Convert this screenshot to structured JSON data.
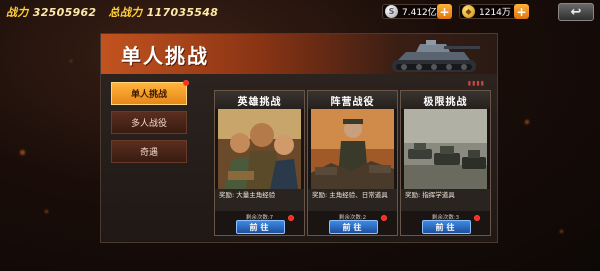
{
  "top_bar": {
    "power_label": "战力",
    "power_value": "32505962",
    "total_power_label": "总战力",
    "total_power_value": "117035548",
    "silver_amount": "7.412亿",
    "gold_amount": "1214万",
    "add_symbol": "+"
  },
  "panel": {
    "title": "单人挑战"
  },
  "nav": {
    "items": [
      {
        "label": "单人挑战"
      },
      {
        "label": "多人战役"
      },
      {
        "label": "奇遇"
      }
    ]
  },
  "cards": [
    {
      "title": "英雄挑战",
      "reward": "奖励: 大量主角经验",
      "remaining": "剩余次数:7",
      "button": "前往"
    },
    {
      "title": "阵营战役",
      "reward": "奖励: 主角经验、日常道具",
      "remaining": "剩余次数:2",
      "button": "前往"
    },
    {
      "title": "极限挑战",
      "reward": "奖励: 指挥学道具",
      "remaining": "剩余次数:3",
      "button": "前往"
    }
  ],
  "colors": {
    "accent_orange": "#e7861a",
    "button_blue": "#1c4f9e",
    "header_red": "#c2531f",
    "notification_red": "#ff2a1a"
  },
  "icons": {
    "silver_currency": "silver-coin-icon",
    "gold_currency": "gold-coin-icon",
    "back": "back-arrow-icon"
  }
}
